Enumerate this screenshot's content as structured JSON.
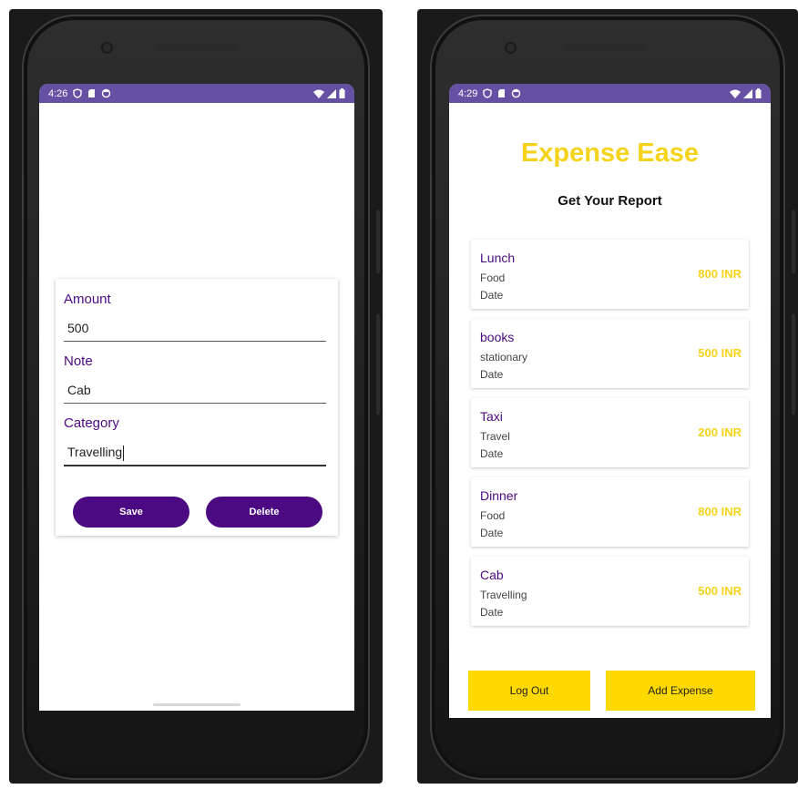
{
  "colors": {
    "status_bar": "#6650a4",
    "primary": "#4b0a82",
    "accent_yellow": "#f5d31a",
    "button_yellow": "#fdd900"
  },
  "left_screen": {
    "status": {
      "time": "4:26",
      "left_icons": [
        "shield-icon",
        "sd-card-icon",
        "sync-icon"
      ],
      "right_icons": [
        "wifi-icon",
        "signal-icon",
        "battery-icon"
      ]
    },
    "form": {
      "amount_label": "Amount",
      "amount_value": "500",
      "note_label": "Note",
      "note_value": "Cab",
      "category_label": "Category",
      "category_value": "Travelling",
      "save_label": "Save",
      "delete_label": "Delete"
    }
  },
  "right_screen": {
    "status": {
      "time": "4:29",
      "left_icons": [
        "shield-icon",
        "sd-card-icon",
        "sync-icon"
      ],
      "right_icons": [
        "wifi-icon",
        "signal-icon",
        "battery-icon"
      ]
    },
    "title": "Expense Ease",
    "subtitle": "Get Your Report",
    "expenses": [
      {
        "note": "Lunch",
        "category": "Food",
        "date": "Date",
        "amount": "800 INR"
      },
      {
        "note": "books",
        "category": "stationary",
        "date": "Date",
        "amount": "500 INR"
      },
      {
        "note": "Taxi",
        "category": "Travel",
        "date": "Date",
        "amount": "200 INR"
      },
      {
        "note": "Dinner",
        "category": "Food",
        "date": "Date",
        "amount": "800 INR"
      },
      {
        "note": "Cab",
        "category": "Travelling",
        "date": "Date",
        "amount": "500 INR"
      }
    ],
    "logout_label": "Log Out",
    "add_expense_label": "Add Expense"
  }
}
